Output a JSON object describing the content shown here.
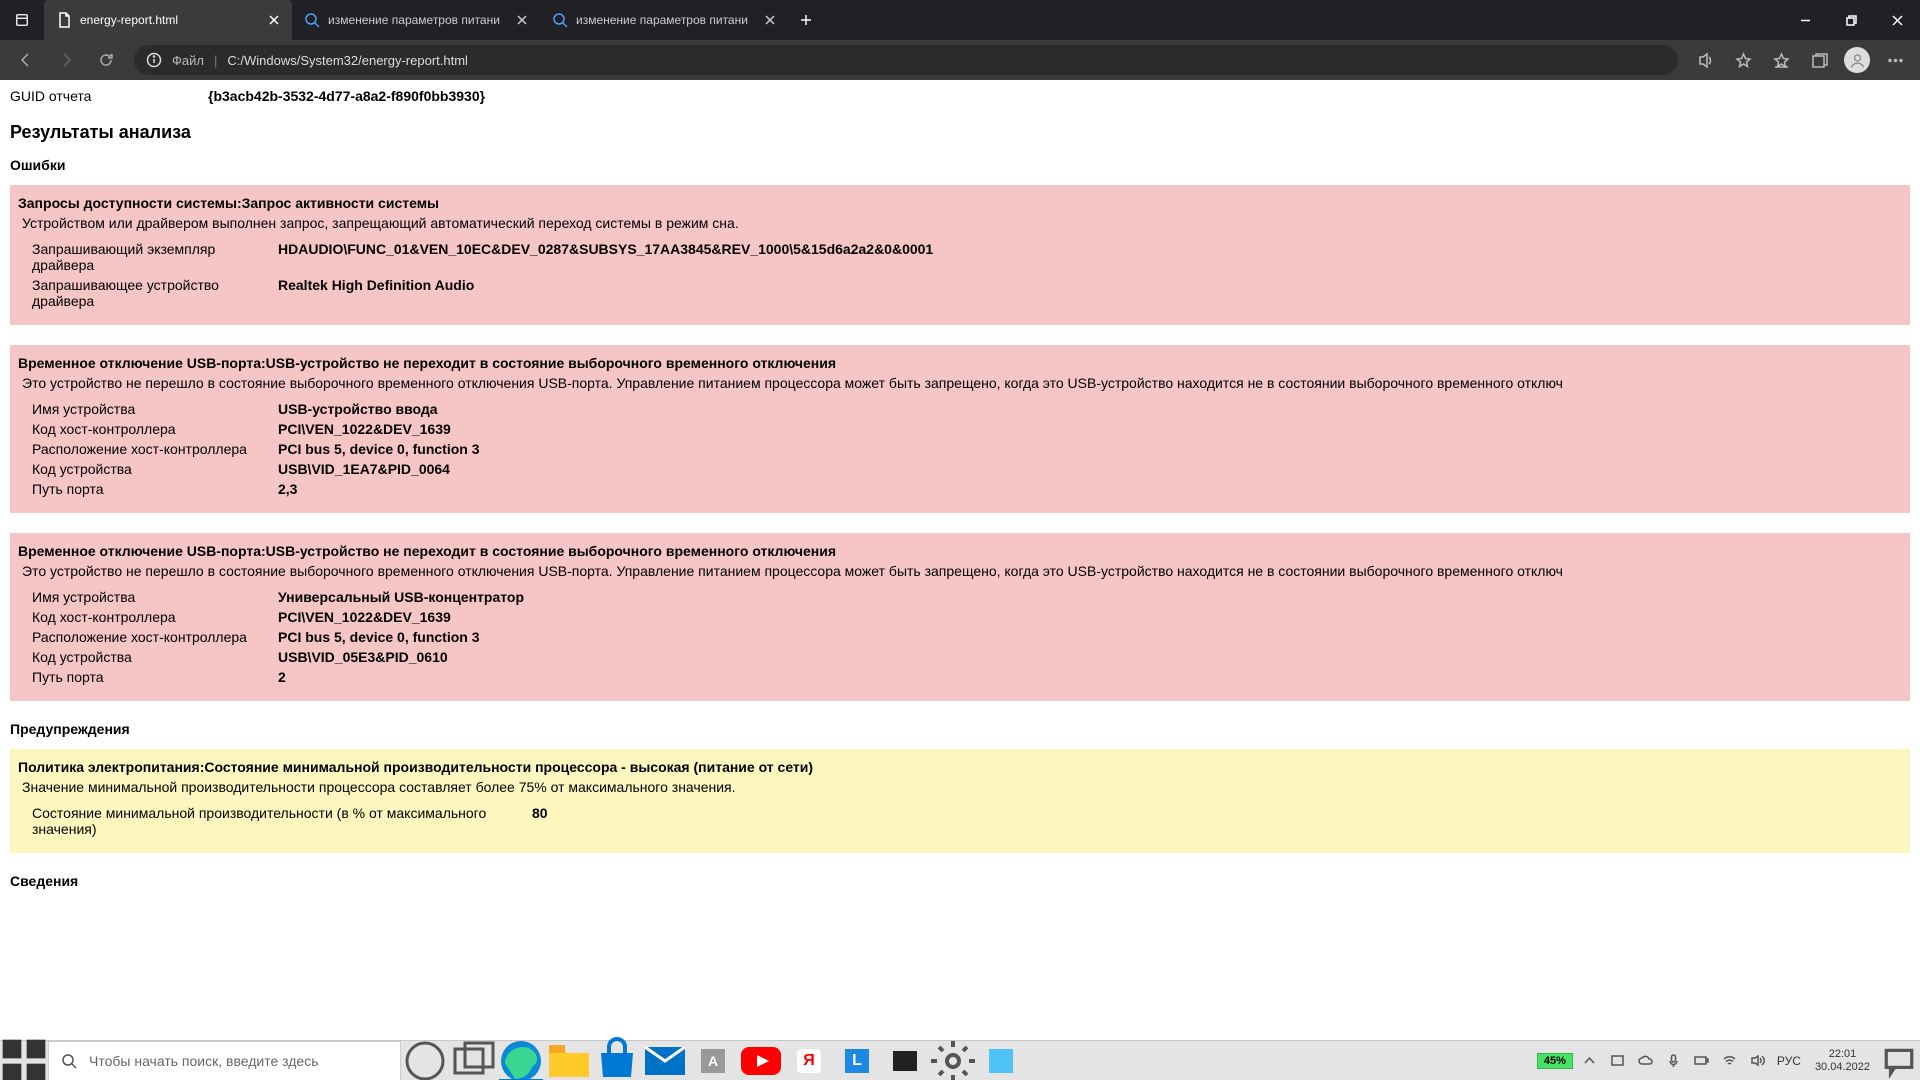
{
  "browser": {
    "tabs": [
      {
        "title": "energy-report.html",
        "icon": "file"
      },
      {
        "title": "изменение параметров питани",
        "icon": "search"
      },
      {
        "title": "изменение параметров питани",
        "icon": "search"
      }
    ],
    "address_filelabel": "Файл",
    "address_path": "C:/Windows/System32/energy-report.html"
  },
  "report": {
    "guid_label": "GUID отчета",
    "guid_value": "{b3acb42b-3532-4d77-a8a2-f890f0bb3930}",
    "analysis_heading": "Результаты анализа",
    "errors_heading": "Ошибки",
    "warnings_heading": "Предупреждения",
    "info_heading": "Сведения",
    "errors": [
      {
        "title": "Запросы доступности системы:Запрос активности системы",
        "desc": "Устройством или драйвером выполнен запрос, запрещающий автоматический переход системы в режим сна.",
        "rows": [
          {
            "k": "Запрашивающий экземпляр драйвера",
            "v": "HDAUDIO\\FUNC_01&VEN_10EC&DEV_0287&SUBSYS_17AA3845&REV_1000\\5&15d6a2a2&0&0001"
          },
          {
            "k": "Запрашивающее устройство драйвера",
            "v": "Realtek High Definition Audio"
          }
        ]
      },
      {
        "title": "Временное отключение USB-порта:USB-устройство не переходит в состояние выборочного временного отключения",
        "desc": "Это устройство не перешло в состояние выборочного временного отключения USB-порта. Управление питанием процессора может быть запрещено, когда это USB-устройство находится не в состоянии выборочного временного отключ",
        "rows": [
          {
            "k": "Имя устройства",
            "v": "USB-устройство ввода"
          },
          {
            "k": "Код хост-контроллера",
            "v": "PCI\\VEN_1022&DEV_1639"
          },
          {
            "k": "Расположение хост-контроллера",
            "v": "PCI bus 5, device 0, function 3"
          },
          {
            "k": "Код устройства",
            "v": "USB\\VID_1EA7&PID_0064"
          },
          {
            "k": "Путь порта",
            "v": "2,3"
          }
        ]
      },
      {
        "title": "Временное отключение USB-порта:USB-устройство не переходит в состояние выборочного временного отключения",
        "desc": "Это устройство не перешло в состояние выборочного временного отключения USB-порта. Управление питанием процессора может быть запрещено, когда это USB-устройство находится не в состоянии выборочного временного отключ",
        "rows": [
          {
            "k": "Имя устройства",
            "v": "Универсальный USB-концентратор"
          },
          {
            "k": "Код хост-контроллера",
            "v": "PCI\\VEN_1022&DEV_1639"
          },
          {
            "k": "Расположение хост-контроллера",
            "v": "PCI bus 5, device 0, function 3"
          },
          {
            "k": "Код устройства",
            "v": "USB\\VID_05E3&PID_0610"
          },
          {
            "k": "Путь порта",
            "v": "2"
          }
        ]
      }
    ],
    "warnings": [
      {
        "title": "Политика электропитания:Состояние минимальной производительности процессора - высокая (питание от сети)",
        "desc": "Значение минимальной производительности процессора составляет более 75% от максимального значения.",
        "rows": [
          {
            "k": "Состояние минимальной производительности (в % от максимального значения)",
            "v": "80"
          }
        ]
      }
    ]
  },
  "taskbar": {
    "search_placeholder": "Чтобы начать поиск, введите здесь",
    "battery": "45%",
    "lang": "РУС",
    "time": "22:01",
    "date": "30.04.2022"
  }
}
